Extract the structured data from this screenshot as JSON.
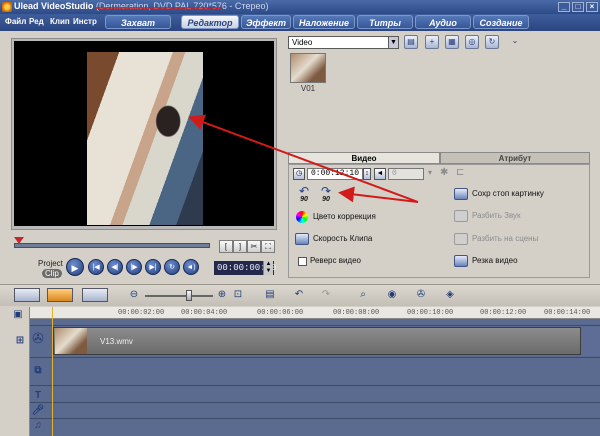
{
  "window": {
    "title": "Ulead VideoStudio",
    "subtitle": "(Dermeration, DVD PAL 720*576 - Стерео)",
    "minimize_glyph": "_",
    "maximize_glyph": "□",
    "close_glyph": "×"
  },
  "menu": {
    "items": [
      "Файл",
      "Ред",
      "Клип",
      "Инстр"
    ]
  },
  "steps": [
    {
      "label": "Захват"
    },
    {
      "label": "Редактор"
    },
    {
      "label": "Эффект"
    },
    {
      "label": "Наложение"
    },
    {
      "label": "Титры"
    },
    {
      "label": "Аудио"
    },
    {
      "label": "Создание"
    }
  ],
  "preview": {
    "project_label": "Project",
    "clip_label": "Clip",
    "timecode": "00:00:00:00",
    "mark_in": "[",
    "mark_out": "]"
  },
  "library": {
    "category": "Video",
    "thumbnail_label": "V01"
  },
  "options": {
    "tabs": [
      "Видео",
      "Атрибут"
    ],
    "duration": "0:00:12:10",
    "volume": "0",
    "rotate_left": "90",
    "rotate_right": "90",
    "color_correction": "Цвето коррекция",
    "clip_speed": "Скорость Клипа",
    "reverse_video": "Реверс видео",
    "save_still": "Сохр стоп картинку",
    "split_audio": "Разбить Звук",
    "split_by_scene": "Разбить на сцены",
    "trim_video": "Резка видео"
  },
  "timeline": {
    "ticks": [
      "00:00:02:00",
      "00:00:04:00",
      "00:00:06:00",
      "00:00:08:00",
      "00:00:10:00",
      "00:00:12:00",
      "00:00:14:00"
    ],
    "clip_name": "V13.wmv",
    "zoom_minus": "⊖",
    "zoom_plus": "⊕"
  },
  "colors": {
    "titlebar": "#2c4a86",
    "annotation_arrow": "#d11a1a",
    "timeline_bg": "#5b6a8f"
  }
}
